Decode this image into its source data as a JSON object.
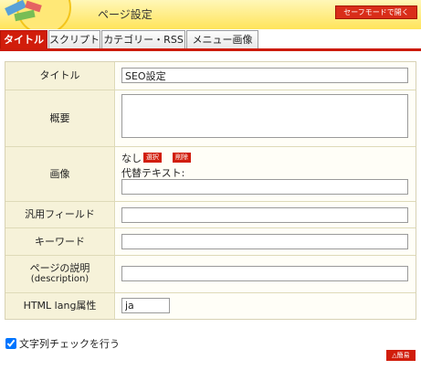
{
  "header": {
    "title": "ページ設定",
    "safe_mode_label": "セーフモードで開く"
  },
  "tabs": [
    {
      "label": "タイトル",
      "active": true
    },
    {
      "label": "スクリプト",
      "active": false
    },
    {
      "label": "カテゴリー・RSS",
      "active": false
    },
    {
      "label": "メニュー画像",
      "active": false
    }
  ],
  "form": {
    "title": {
      "label": "タイトル",
      "value": "SEO設定"
    },
    "summary": {
      "label": "概要",
      "value": ""
    },
    "image": {
      "label": "画像",
      "status": "なし",
      "select_label": "選択",
      "delete_label": "削除",
      "alt_label": "代替テキスト:",
      "alt_value": ""
    },
    "general_field": {
      "label": "汎用フィールド",
      "value": ""
    },
    "keywords": {
      "label": "キーワード",
      "value": ""
    },
    "description": {
      "label": "ページの説明",
      "sublabel": "(description)",
      "value": ""
    },
    "lang": {
      "label": "HTML lang属性",
      "value": "ja"
    }
  },
  "check_strings": {
    "label": "文字列チェックを行う",
    "checked": true
  },
  "simple_label": "△簡易",
  "colors": {
    "accent": "#d11d0b",
    "header_bg": "#ffe45a",
    "label_bg": "#f6f2d9"
  }
}
